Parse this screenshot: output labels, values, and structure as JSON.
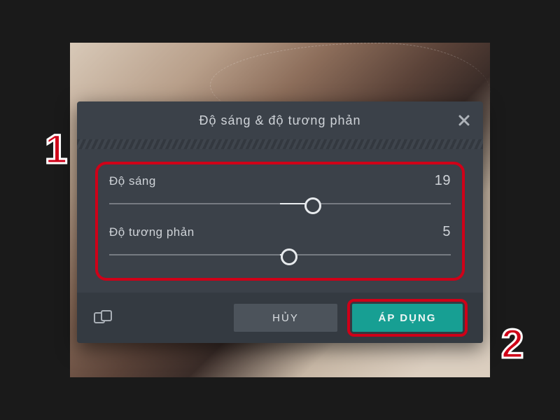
{
  "dialog": {
    "title": "Độ sáng & độ tương phản",
    "slider1": {
      "label": "Độ sáng",
      "value": 19,
      "min": -100,
      "max": 100
    },
    "slider2": {
      "label": "Độ tương phản",
      "value": 5,
      "min": -100,
      "max": 100
    },
    "cancel_label": "HỦY",
    "apply_label": "ÁP DỤNG",
    "compare_icon_name": "compare-icon"
  },
  "annotations": {
    "step1": "1",
    "step2": "2"
  },
  "colors": {
    "annotation": "#cf0018",
    "accent": "#179f93",
    "panel": "#3b4149"
  }
}
